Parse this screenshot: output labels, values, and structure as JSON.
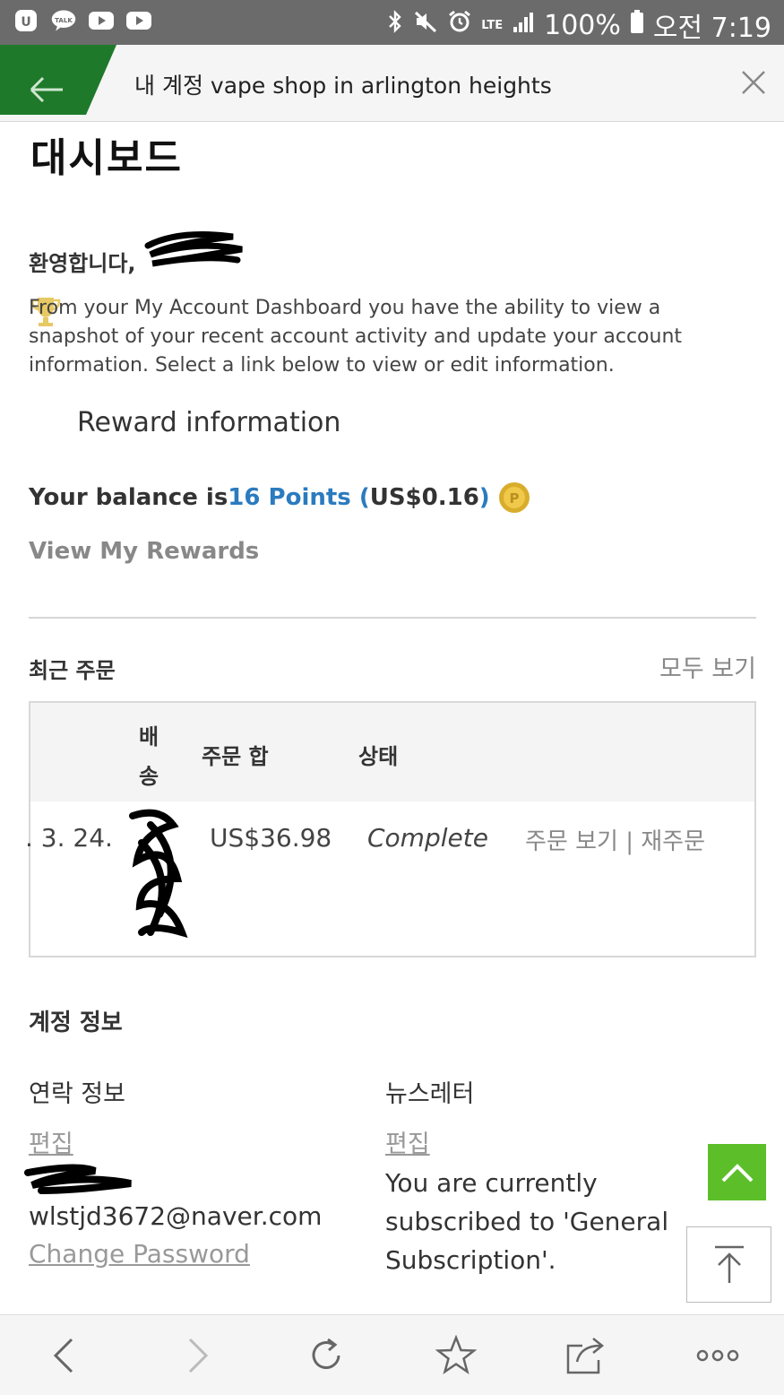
{
  "status_bar": {
    "lte": "LTE",
    "battery": "100%",
    "time": "오전 7:19",
    "left_icons": [
      "app-icon",
      "kakaotalk-icon",
      "youtube-icon",
      "youtube-icon"
    ],
    "right_icons": [
      "bluetooth-icon",
      "mute-icon",
      "alarm-icon",
      "lte-icon",
      "signal-icon",
      "battery-icon"
    ]
  },
  "topbar": {
    "title": "내 계정 vape shop in arlington heights",
    "accent_color": "#1e7a2a"
  },
  "page": {
    "title": "대시보드",
    "welcome": "환영합니다,",
    "intro": "From your My Account Dashboard you have the ability to view a snapshot of your recent account activity and update your account information. Select a link below to view or edit information."
  },
  "rewards": {
    "heading": "Reward information",
    "balance_prefix": "Your balance is ",
    "points": "16 Points (",
    "amount": "US$0.16",
    "close_paren": ")",
    "view_link": "View My Rewards"
  },
  "orders": {
    "heading": "최근 주문",
    "view_all": "모두 보기",
    "columns": {
      "ship_1": "배",
      "ship_2": "송",
      "total": "주문 합",
      "status": "상태"
    },
    "rows": [
      {
        "date": ". 3. 24.",
        "total": "US$36.98",
        "status": "Complete",
        "view": "주문 보기",
        "separator": "|",
        "reorder": "재주문"
      }
    ]
  },
  "account": {
    "heading": "계정 정보",
    "contact_heading": "연락 정보",
    "contact_edit": "편집",
    "email": "wlstjd3672@naver.com",
    "change_password": "Change Password",
    "newsletter_heading": "뉴스레터",
    "newsletter_edit": "편집",
    "newsletter_text": "You are currently subscribed to 'General Subscription'."
  },
  "colors": {
    "link_blue": "#2b7bbf",
    "scroll_green": "#5cbf2a"
  },
  "bottom_nav": [
    "back-icon",
    "forward-icon",
    "refresh-icon",
    "bookmark-star-icon",
    "share-icon",
    "more-icon"
  ]
}
